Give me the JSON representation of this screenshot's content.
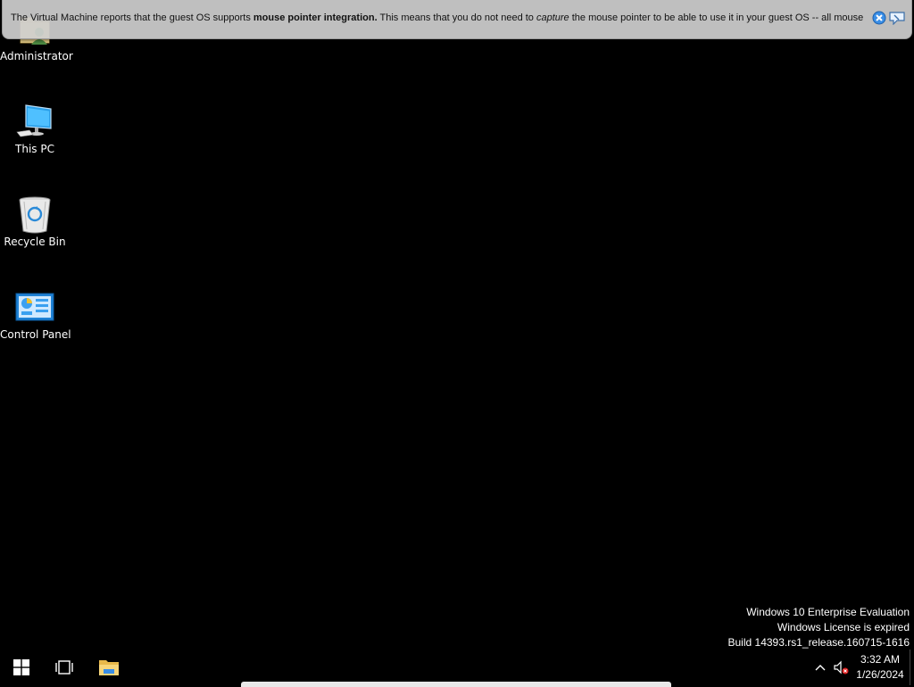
{
  "vm_banner": {
    "msg_prefix": "The Virtual Machine reports that the guest OS supports ",
    "msg_bold": "mouse pointer integration.",
    "msg_mid": " This means that you do not need to ",
    "msg_italic": "capture",
    "msg_suffix": " the mouse pointer to be able to use it in your guest OS -- all mouse",
    "close_icon": "close-circle-icon",
    "pin_icon": "speech-bubble-icon"
  },
  "desktop": {
    "icons": [
      {
        "label": "Administrator",
        "icon": "user-folder-icon"
      },
      {
        "label": "This PC",
        "icon": "computer-icon"
      },
      {
        "label": "Recycle Bin",
        "icon": "recycle-bin-icon"
      },
      {
        "label": "Control Panel",
        "icon": "control-panel-icon"
      }
    ]
  },
  "watermark": {
    "line1": "Windows 10 Enterprise Evaluation",
    "line2": "Windows License is expired",
    "line3": "Build 14393.rs1_release.160715-1616"
  },
  "taskbar": {
    "start_icon": "windows-logo-icon",
    "task_view_icon": "task-view-icon",
    "explorer_icon": "file-explorer-icon",
    "tray_chevron_icon": "chevron-up-icon",
    "volume_icon": "speaker-muted-icon",
    "clock_time": "3:32 AM",
    "clock_date": "1/26/2024"
  },
  "colors": {
    "desktop_background": "#000000",
    "banner_background": "#cdcdcd",
    "windows_blue": "#1e90ff"
  }
}
